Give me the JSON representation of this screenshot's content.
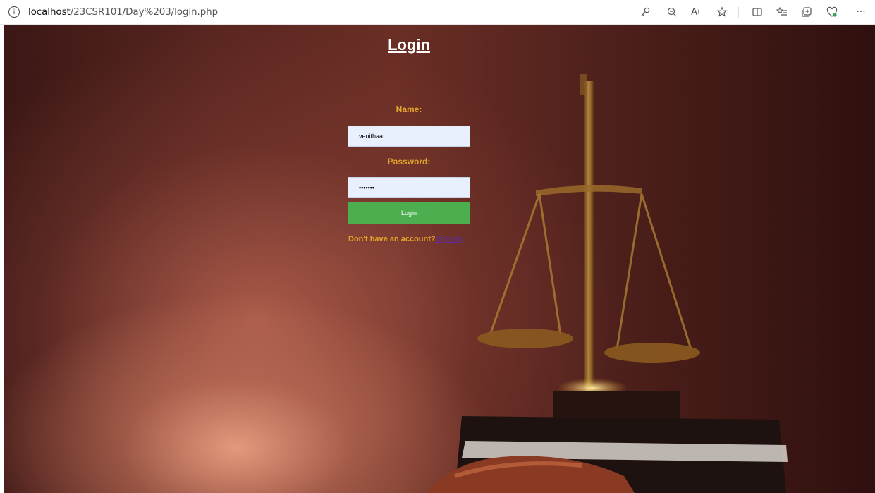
{
  "browser": {
    "url_host": "localhost",
    "url_path": "/23CSR101/Day%203/login.php",
    "toolbar_icons": [
      "key-icon",
      "zoom-out-icon",
      "read-aloud-icon",
      "favorite-star-icon",
      "split-screen-icon",
      "favorites-list-icon",
      "collections-icon",
      "browser-essentials-icon",
      "more-menu-icon"
    ]
  },
  "page": {
    "title": "Login",
    "name_label": "Name:",
    "name_value": "venithaa",
    "password_label": "Password:",
    "password_value": "•••••••",
    "login_button": "Login",
    "signup_prompt": "Don't have an account?",
    "signup_link": "Sign up"
  },
  "colors": {
    "label": "#e3a62a",
    "button": "#4cae4f",
    "input_bg": "#e8f0fe",
    "link": "#5b2bb6"
  }
}
